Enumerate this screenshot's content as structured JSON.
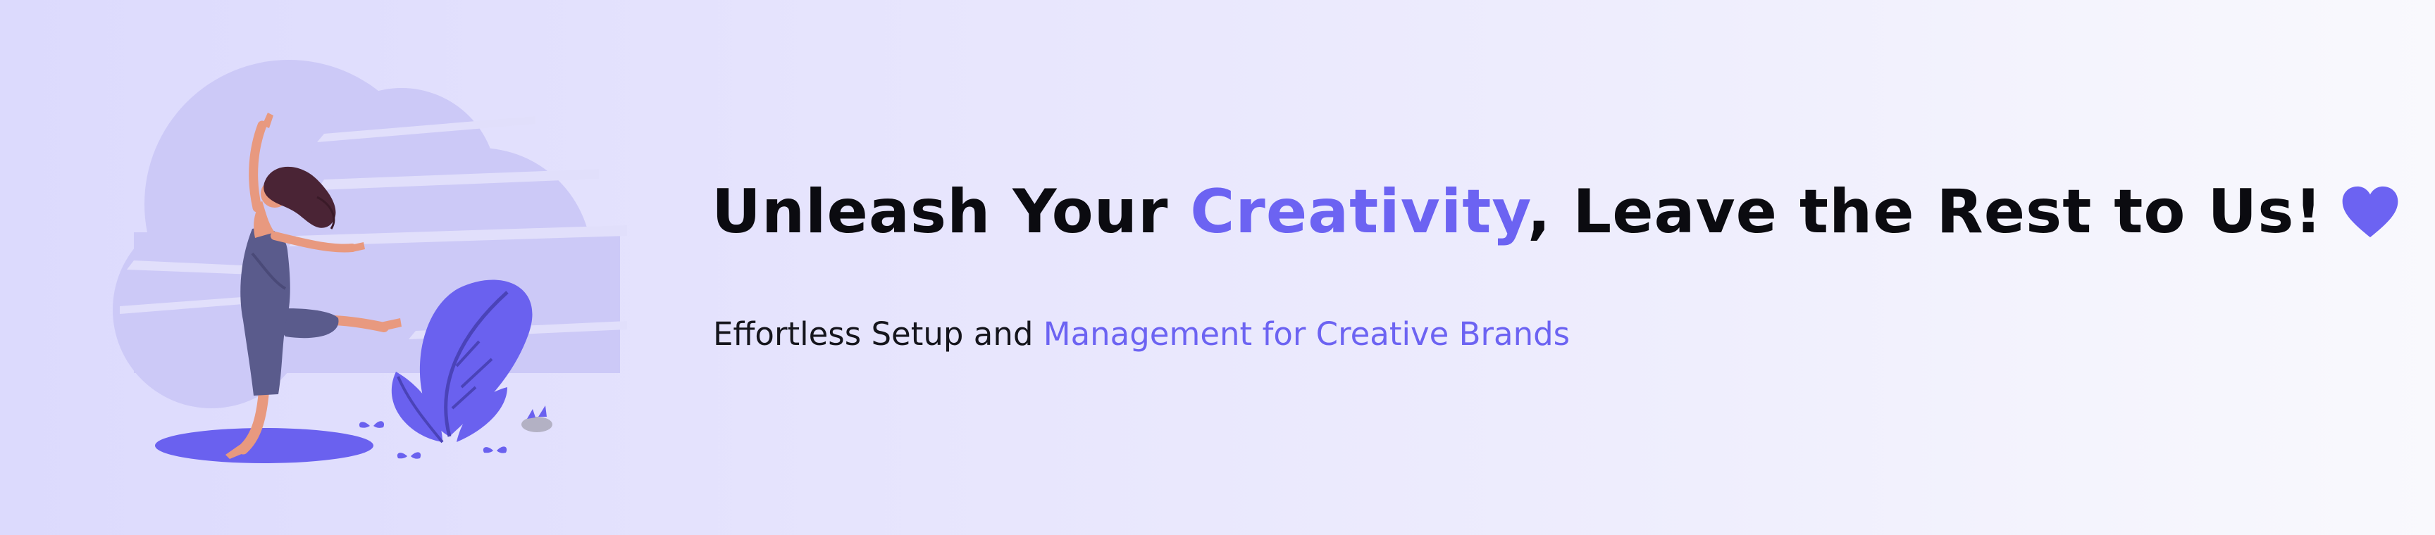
{
  "headline": {
    "part1": "Unleash Your ",
    "accent": "Creativity",
    "part2": ", Leave the Rest to Us!",
    "icon": "heart-icon"
  },
  "subline": {
    "part1": "Effortless Setup and ",
    "accent": "Management for Creative Brands"
  },
  "illustration": {
    "subject": "woman-dancing-illustration"
  },
  "colors": {
    "accent": "#6c63f2",
    "background_start": "#dcdafd",
    "background_end": "#f9f9fd",
    "text": "#0b0b10",
    "blob": "#ccc8f6",
    "skin": "#e8997f",
    "hair": "#4a2435",
    "outfit": "#5a5b8c"
  }
}
